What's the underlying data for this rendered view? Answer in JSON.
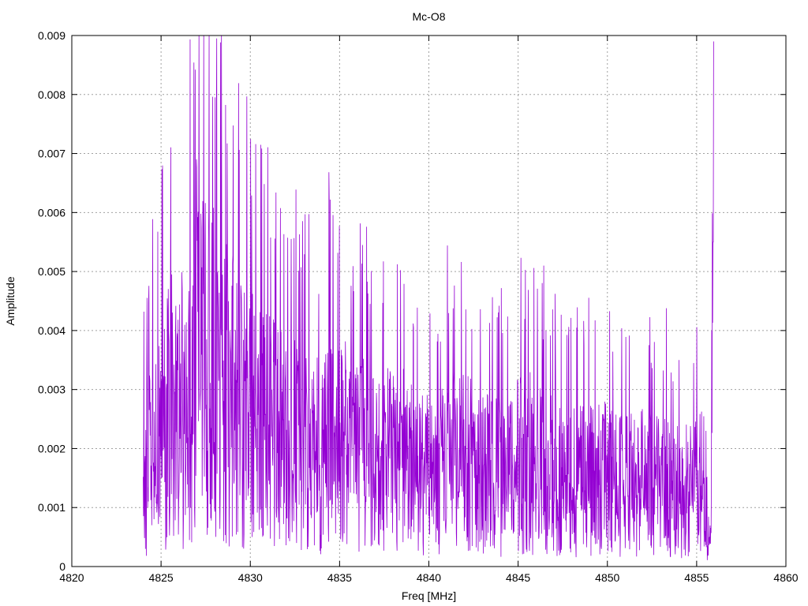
{
  "chart_data": {
    "type": "line",
    "title": "Mc-O8",
    "xlabel": "Freq [MHz]",
    "ylabel": "Amplitude",
    "xlim": [
      4820,
      4860
    ],
    "ylim": [
      0,
      0.009
    ],
    "x_ticks": [
      "4820",
      "4825",
      "4830",
      "4835",
      "4840",
      "4845",
      "4850",
      "4855",
      "4860"
    ],
    "y_ticks": [
      "0",
      "0.001",
      "0.002",
      "0.003",
      "0.004",
      "0.005",
      "0.006",
      "0.007",
      "0.008",
      "0.009"
    ],
    "grid": true,
    "legend": "none",
    "line_color": "#9400d3",
    "series": [
      {
        "x": [
          4824.0,
          4824.5,
          4825.0,
          4825.5,
          4826.0,
          4826.3,
          4826.6,
          4826.9,
          4827.05,
          4827.3,
          4827.6,
          4827.9,
          4828.2,
          4828.6,
          4829.0,
          4829.4,
          4829.8,
          4830.2,
          4830.5,
          4830.9,
          4831.3,
          4831.7,
          4832.2,
          4832.6,
          4833.1,
          4833.6,
          4834.1,
          4834.6,
          4835.1,
          4835.6,
          4836.1,
          4836.6,
          4837.1,
          4837.6,
          4838.1,
          4838.6,
          4839.1,
          4839.6,
          4840.1,
          4840.6,
          4841.2,
          4841.8,
          4842.4,
          4843.0,
          4843.6,
          4844.2,
          4844.8,
          4845.4,
          4846.0,
          4846.7,
          4847.3,
          4847.9,
          4848.5,
          4849.1,
          4849.7,
          4850.3,
          4850.9,
          4851.5,
          4852.1,
          4852.6,
          4853.2,
          4853.8,
          4854.4,
          4854.9,
          4855.3,
          4855.6,
          4855.8,
          4855.95
        ],
        "y": [
          0.0021,
          0.0025,
          0.0028,
          0.0036,
          0.0039,
          0.0034,
          0.0042,
          0.0047,
          0.0052,
          0.0048,
          0.0045,
          0.0044,
          0.0041,
          0.004,
          0.0038,
          0.0037,
          0.0035,
          0.0033,
          0.0032,
          0.0031,
          0.003,
          0.0029,
          0.0027,
          0.0028,
          0.0026,
          0.0025,
          0.0026,
          0.0031,
          0.0029,
          0.0027,
          0.0026,
          0.0025,
          0.0024,
          0.0025,
          0.0023,
          0.0024,
          0.0022,
          0.0023,
          0.002,
          0.0021,
          0.0024,
          0.0026,
          0.0023,
          0.0022,
          0.0021,
          0.002,
          0.0022,
          0.0024,
          0.0023,
          0.0021,
          0.002,
          0.0019,
          0.002,
          0.0022,
          0.0021,
          0.0019,
          0.0018,
          0.0019,
          0.002,
          0.0018,
          0.0019,
          0.0017,
          0.0018,
          0.0019,
          0.0013,
          0.0011,
          0.001,
          0.0089
        ]
      }
    ]
  }
}
